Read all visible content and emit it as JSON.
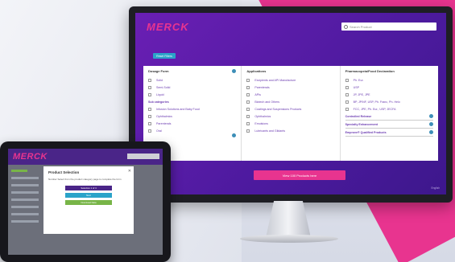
{
  "brand": {
    "logo": "MERCK",
    "accent": "#e8348f",
    "primary": "#5b1fa8"
  },
  "desktop": {
    "search_placeholder": "Search Product",
    "reset_button": "Reset Filters",
    "columns": [
      {
        "heading": "Dosage Form",
        "items": [
          "Solid",
          "Semi-Solid",
          "Liquid"
        ],
        "subheading": "Sub categories",
        "sub_items": [
          "Infusion Solutions and Baby Food",
          "Ophthalmics",
          "Parenterals",
          "Oral"
        ]
      },
      {
        "heading": "Applications",
        "items": [
          "Excipients and API Manufacture",
          "Parenterals",
          "APIs",
          "Biotech and Others",
          "Coatings and Suspensions Products",
          "Ophthalmics",
          "Emulsions",
          "Lubricants and Glidants"
        ]
      },
      {
        "heading": "Pharmacopeia/Food Declaration",
        "items": [
          "Ph. Eur.",
          "USP",
          "JP, JPE, JPE",
          "BP, JP/NF, USP, Ph. Franc, Ph. Helv.",
          "FCC, JPE, Ph. Eur., USP, JECFA"
        ],
        "expanders": [
          "Controlled Release",
          "Specialty Enhancement",
          "Emprove® Qualified Products"
        ]
      }
    ],
    "cta": "View 100 Products here",
    "language": "English"
  },
  "tablet": {
    "logo": "MERCK",
    "modal": {
      "title": "Product Selection",
      "body": "Number\nSelect from the product category page to complete the form",
      "buttons": [
        "Selection 1 of 4",
        "Next",
        "Download Data"
      ]
    }
  }
}
